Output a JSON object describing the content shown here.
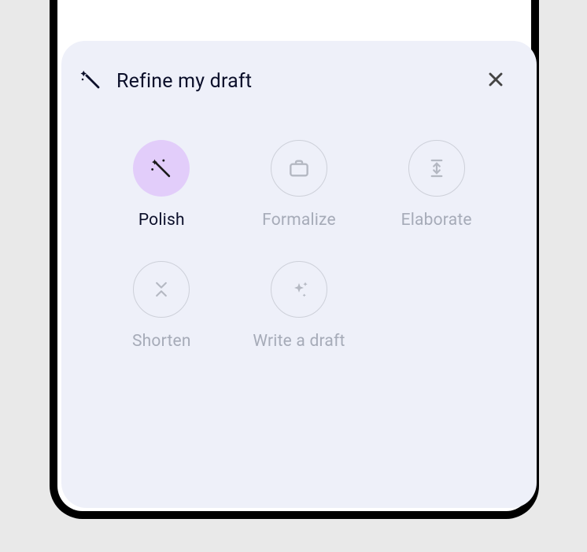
{
  "sheet": {
    "title": "Refine my draft",
    "options": [
      {
        "label": "Polish",
        "icon": "magic-wand-icon",
        "selected": true
      },
      {
        "label": "Formalize",
        "icon": "briefcase-icon",
        "selected": false
      },
      {
        "label": "Elaborate",
        "icon": "expand-icon",
        "selected": false
      },
      {
        "label": "Shorten",
        "icon": "collapse-icon",
        "selected": false
      },
      {
        "label": "Write a draft",
        "icon": "sparkles-icon",
        "selected": false
      }
    ]
  }
}
